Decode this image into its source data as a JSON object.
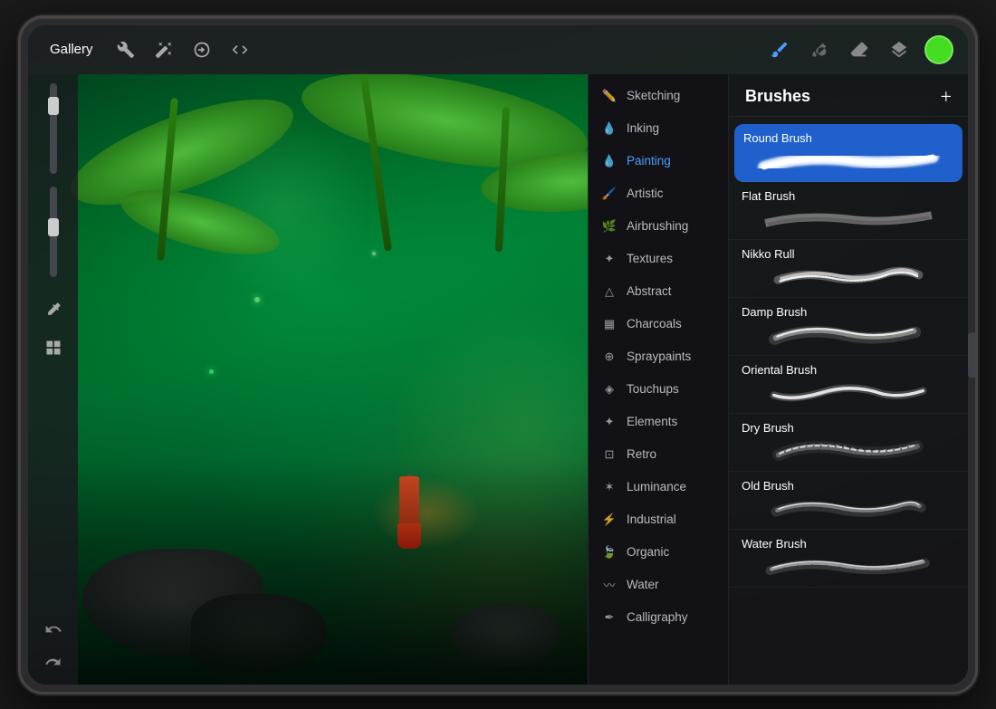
{
  "toolbar": {
    "gallery_label": "Gallery",
    "tools": [
      {
        "name": "wrench-icon",
        "label": "Adjustments"
      },
      {
        "name": "wand-icon",
        "label": "Select"
      },
      {
        "name": "transform-icon",
        "label": "Transform"
      },
      {
        "name": "draw-icon",
        "label": "Draw"
      }
    ],
    "right_tools": [
      {
        "name": "brush-tool-icon",
        "label": "Brush",
        "active": true
      },
      {
        "name": "smudge-icon",
        "label": "Smudge"
      },
      {
        "name": "eraser-icon",
        "label": "Eraser"
      },
      {
        "name": "layers-icon",
        "label": "Layers"
      }
    ],
    "color_dot": {
      "color": "#44dd22"
    }
  },
  "left_panel": {
    "sliders": [
      {
        "name": "size-slider",
        "label": "Brush Size"
      },
      {
        "name": "opacity-slider",
        "label": "Opacity"
      }
    ],
    "tools": [
      {
        "name": "eyedropper-icon",
        "label": "Eyedropper"
      },
      {
        "name": "canvas-settings-icon",
        "label": "Canvas"
      }
    ],
    "undo_label": "↩",
    "redo_label": "↪"
  },
  "brush_panel": {
    "title": "Brushes",
    "add_button": "+",
    "categories": [
      {
        "id": "sketching",
        "label": "Sketching",
        "icon": "pencil"
      },
      {
        "id": "inking",
        "label": "Inking",
        "icon": "ink"
      },
      {
        "id": "painting",
        "label": "Painting",
        "icon": "drop",
        "active": true
      },
      {
        "id": "artistic",
        "label": "Artistic",
        "icon": "brush"
      },
      {
        "id": "airbrushing",
        "label": "Airbrushing",
        "icon": "airbrush"
      },
      {
        "id": "textures",
        "label": "Textures",
        "icon": "grid"
      },
      {
        "id": "abstract",
        "label": "Abstract",
        "icon": "triangle"
      },
      {
        "id": "charcoals",
        "label": "Charcoals",
        "icon": "building"
      },
      {
        "id": "spraypaints",
        "label": "Spraypaints",
        "icon": "spray"
      },
      {
        "id": "touchups",
        "label": "Touchups",
        "icon": "stamp"
      },
      {
        "id": "elements",
        "label": "Elements",
        "icon": "sparkle"
      },
      {
        "id": "retro",
        "label": "Retro",
        "icon": "game"
      },
      {
        "id": "luminance",
        "label": "Luminance",
        "icon": "star"
      },
      {
        "id": "industrial",
        "label": "Industrial",
        "icon": "bolt"
      },
      {
        "id": "organic",
        "label": "Organic",
        "icon": "leaf"
      },
      {
        "id": "water",
        "label": "Water",
        "icon": "wave"
      },
      {
        "id": "calligraphy",
        "label": "Calligraphy",
        "icon": "pen"
      }
    ],
    "brushes": [
      {
        "id": "round-brush",
        "name": "Round Brush",
        "selected": true
      },
      {
        "id": "flat-brush",
        "name": "Flat Brush",
        "selected": false
      },
      {
        "id": "nikko-rull",
        "name": "Nikko Rull",
        "selected": false
      },
      {
        "id": "damp-brush",
        "name": "Damp Brush",
        "selected": false
      },
      {
        "id": "oriental-brush",
        "name": "Oriental Brush",
        "selected": false
      },
      {
        "id": "dry-brush",
        "name": "Dry Brush",
        "selected": false
      },
      {
        "id": "old-brush",
        "name": "Old Brush",
        "selected": false
      },
      {
        "id": "water-brush",
        "name": "Water Brush",
        "selected": false
      }
    ]
  }
}
